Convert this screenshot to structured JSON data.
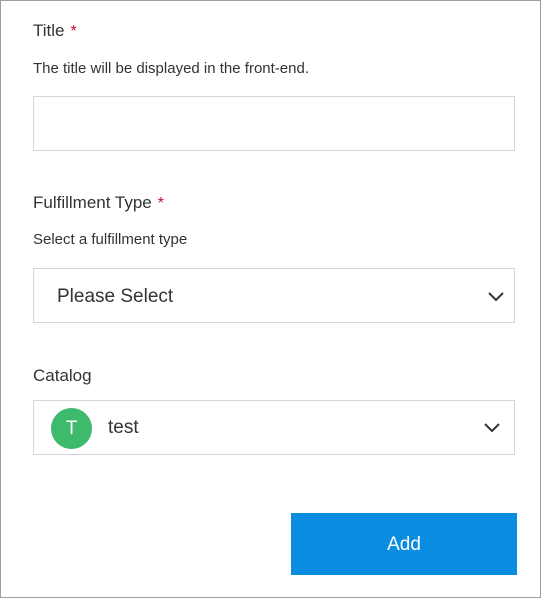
{
  "title_field": {
    "label": "Title",
    "required_marker": "*",
    "hint": "The title will be displayed in the front-end.",
    "value": "",
    "placeholder": ""
  },
  "fulfillment_field": {
    "label": "Fulfillment Type",
    "required_marker": "*",
    "hint": "Select a fulfillment type",
    "selected_value": "Please Select",
    "icon": "chevron-down-icon"
  },
  "catalog_field": {
    "label": "Catalog",
    "avatar_initial": "T",
    "avatar_color": "#3dba6b",
    "selected_value": "test",
    "icon": "chevron-down-icon"
  },
  "actions": {
    "add_label": "Add",
    "add_color": "#0a8ce0"
  }
}
